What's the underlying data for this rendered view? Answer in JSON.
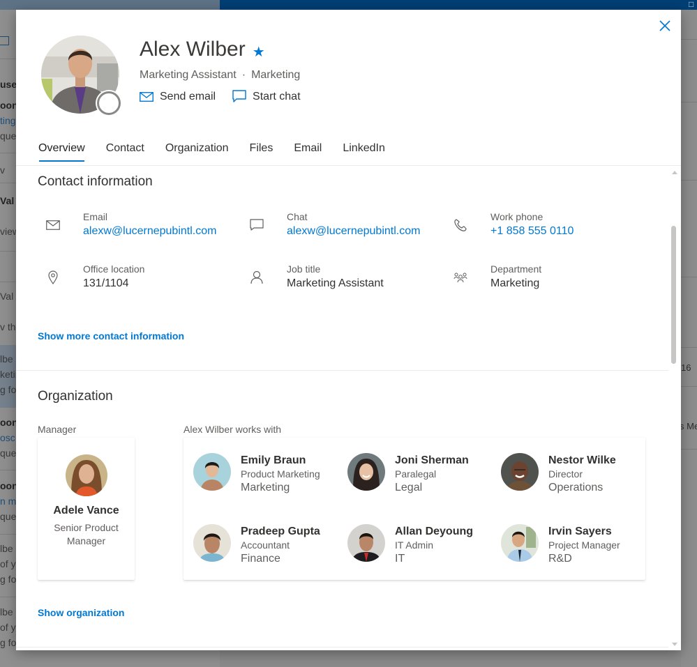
{
  "background": {
    "left_rows": [
      {
        "text": "use",
        "style": "b"
      },
      {
        "text": "oon",
        "style": "b"
      },
      {
        "text": "ting",
        "style": "link"
      },
      {
        "text": "que",
        "style": ""
      },
      {
        "text": "v",
        "style": ""
      },
      {
        "text": "Val",
        "style": "b"
      },
      {
        "text": "view",
        "style": ""
      },
      {
        "text": "Val",
        "style": ""
      },
      {
        "text": "v thi",
        "style": ""
      },
      {
        "text": "lbe",
        "style": ""
      },
      {
        "text": "ketir",
        "style": ""
      },
      {
        "text": "g fo",
        "style": ""
      },
      {
        "text": "oon",
        "style": "b"
      },
      {
        "text": "osc",
        "style": "link"
      },
      {
        "text": "que",
        "style": ""
      },
      {
        "text": "oon",
        "style": "b"
      },
      {
        "text": "n m",
        "style": "link"
      },
      {
        "text": "que",
        "style": ""
      },
      {
        "text": "lbe",
        "style": ""
      },
      {
        "text": "of y",
        "style": ""
      },
      {
        "text": "g fo",
        "style": ""
      },
      {
        "text": "lbe",
        "style": ""
      },
      {
        "text": "of y",
        "style": ""
      },
      {
        "text": "g fo",
        "style": ""
      }
    ],
    "right_texts": [
      "16",
      "s Me"
    ]
  },
  "profile": {
    "name": "Alex Wilber",
    "favorite": true,
    "job_title": "Marketing Assistant",
    "separator": "·",
    "department": "Marketing",
    "presence": "offline",
    "actions": {
      "send_email": "Send email",
      "start_chat": "Start chat"
    }
  },
  "tabs": [
    {
      "label": "Overview",
      "active": true
    },
    {
      "label": "Contact",
      "active": false
    },
    {
      "label": "Organization",
      "active": false
    },
    {
      "label": "Files",
      "active": false
    },
    {
      "label": "Email",
      "active": false
    },
    {
      "label": "LinkedIn",
      "active": false
    }
  ],
  "contact": {
    "title": "Contact information",
    "fields": [
      {
        "icon": "mail-icon",
        "label": "Email",
        "value": "alexw@lucernepubintl.com",
        "link": true
      },
      {
        "icon": "chat-icon",
        "label": "Chat",
        "value": "alexw@lucernepubintl.com",
        "link": true
      },
      {
        "icon": "phone-icon",
        "label": "Work phone",
        "value": "+1 858 555 0110",
        "link": true
      },
      {
        "icon": "location-icon",
        "label": "Office location",
        "value": "131/1104",
        "link": false
      },
      {
        "icon": "person-icon",
        "label": "Job title",
        "value": "Marketing Assistant",
        "link": false
      },
      {
        "icon": "people-icon",
        "label": "Department",
        "value": "Marketing",
        "link": false
      }
    ],
    "show_more": "Show more contact information"
  },
  "organization": {
    "title": "Organization",
    "manager_label": "Manager",
    "manager": {
      "name": "Adele Vance",
      "title": "Senior Product Manager"
    },
    "works_with_label": "Alex Wilber works with",
    "colleagues": [
      {
        "name": "Emily Braun",
        "title": "Product Marketing",
        "department": "Marketing"
      },
      {
        "name": "Joni Sherman",
        "title": "Paralegal",
        "department": "Legal"
      },
      {
        "name": "Nestor Wilke",
        "title": "Director",
        "department": "Operations"
      },
      {
        "name": "Pradeep Gupta",
        "title": "Accountant",
        "department": "Finance"
      },
      {
        "name": "Allan Deyoung",
        "title": "IT Admin",
        "department": "IT"
      },
      {
        "name": "Irvin Sayers",
        "title": "Project Manager",
        "department": "R&D"
      }
    ],
    "show_org": "Show organization"
  },
  "colors": {
    "accent": "#0078d4",
    "topbar": "#003f75",
    "text_primary": "#323130",
    "text_secondary": "#605e5c"
  }
}
